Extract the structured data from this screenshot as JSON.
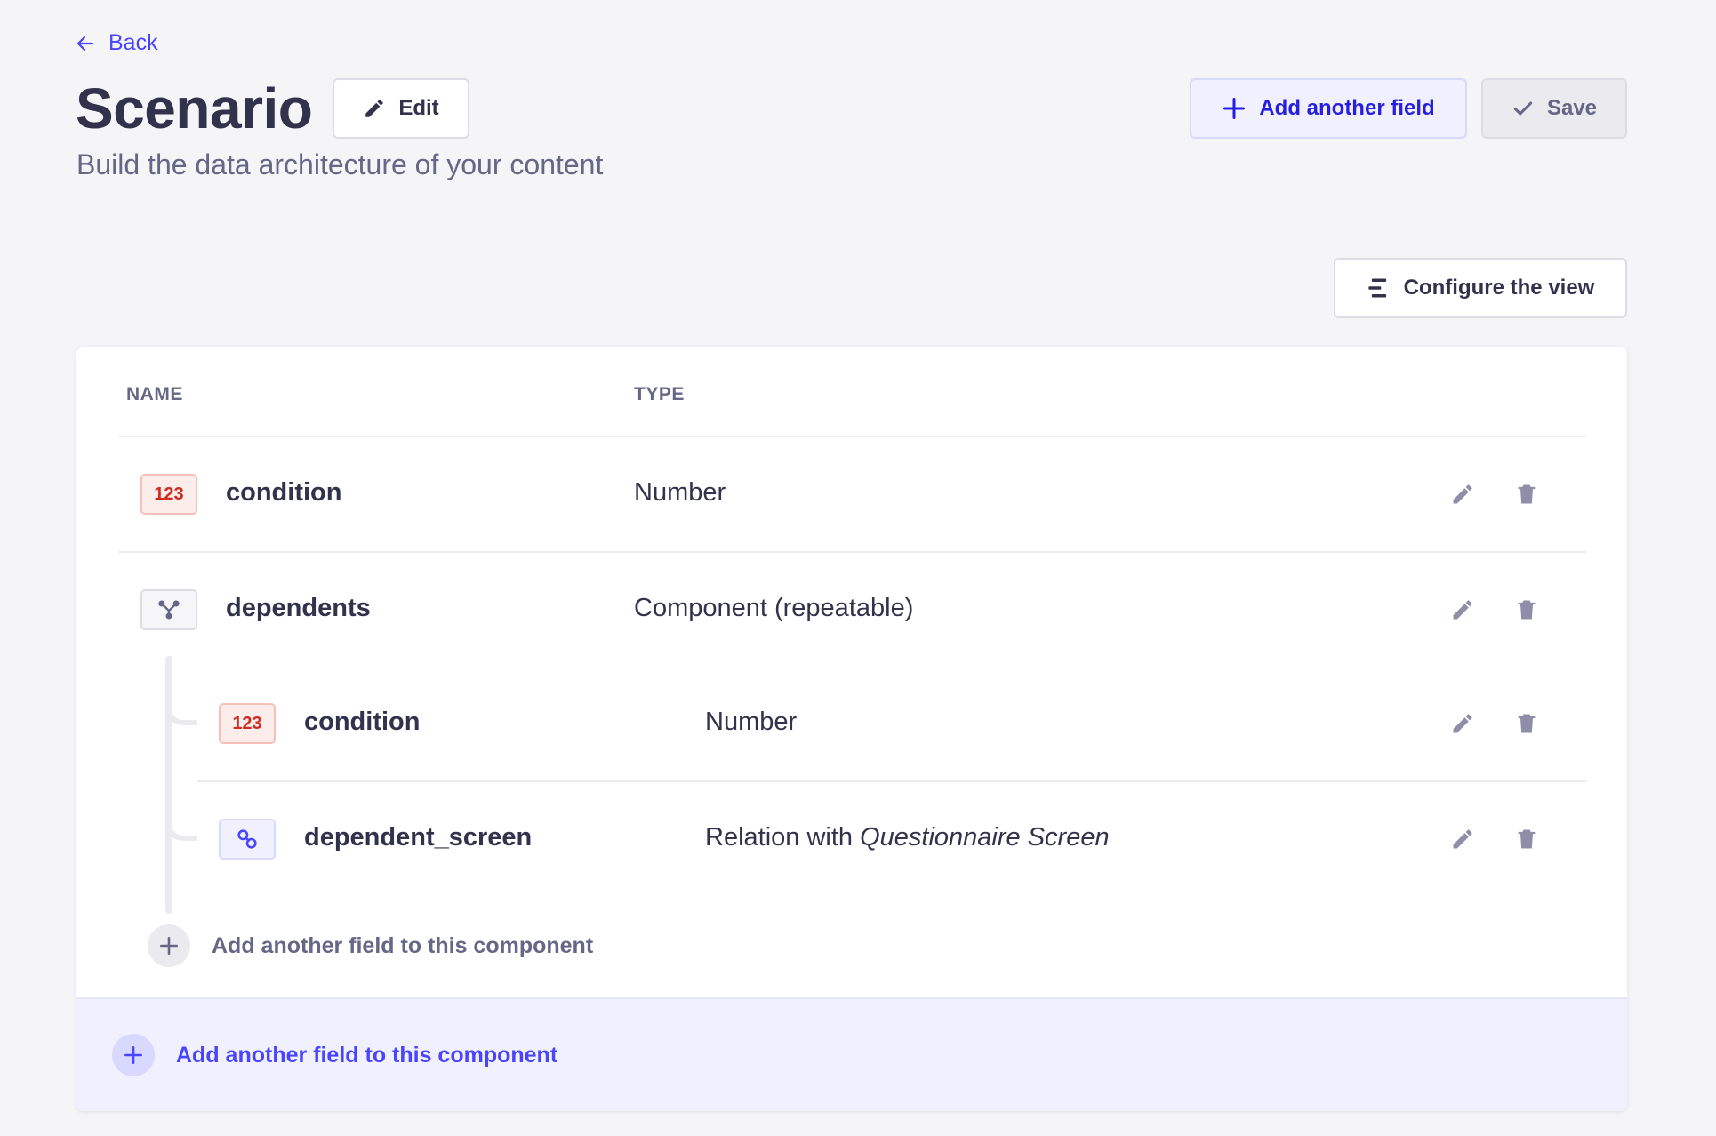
{
  "nav": {
    "back_label": "Back"
  },
  "header": {
    "title": "Scenario",
    "edit_label": "Edit",
    "subtitle": "Build the data architecture of your content",
    "add_field_label": "Add another field",
    "save_label": "Save"
  },
  "toolbar": {
    "configure_label": "Configure the view"
  },
  "table": {
    "columns": [
      "NAME",
      "TYPE"
    ],
    "rows": [
      {
        "icon": "number-icon",
        "icon_text": "123",
        "name": "condition",
        "type": "Number"
      },
      {
        "icon": "component-icon",
        "name": "dependents",
        "type": "Component (repeatable)",
        "children": [
          {
            "icon": "number-icon",
            "icon_text": "123",
            "name": "condition",
            "type": "Number"
          },
          {
            "icon": "relation-icon",
            "name": "dependent_screen",
            "type_prefix": "Relation with ",
            "type_target": "Questionnaire Screen"
          }
        ],
        "add_child_label": "Add another field to this component"
      }
    ]
  },
  "footer": {
    "add_label": "Add another field to this component"
  },
  "colors": {
    "accent": "#4945ff",
    "text": "#32324d",
    "muted": "#666687",
    "number_badge": "#d02b20",
    "background": "#f5f5f8"
  }
}
